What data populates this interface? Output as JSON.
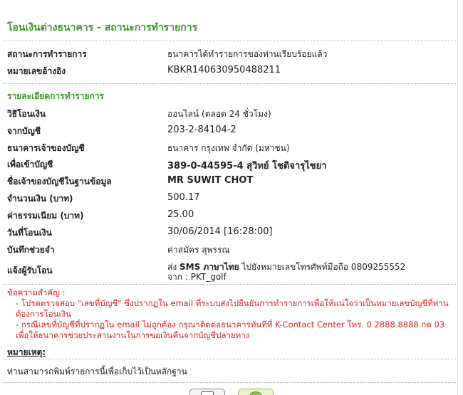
{
  "page": {
    "title": "โอนเงินต่างธนาคาร - สถานะการทำรายการ"
  },
  "status": {
    "status_label": "สถานะการทำรายการ",
    "status_value": "ธนาคารได้ทำรายการของท่านเรียบร้อยแล้ว",
    "ref_label": "หมายเลขอ้างอิง",
    "ref_value": "KBKR140630950488211"
  },
  "details": {
    "section_title": "รายละเอียดการทำรายการ",
    "rows": [
      {
        "label": "วิธีโอนเงิน",
        "value": "ออนไลน์ (ตลอด 24 ชั่วโมง)"
      },
      {
        "label": "จากบัญชี",
        "value": "203-2-84104-2"
      },
      {
        "label": "ธนาคารเจ้าของบัญชี",
        "value": "ธนาคาร กรุงเทพ จำกัด (มหาชน)"
      },
      {
        "label": "เพื่อเข้าบัญชี",
        "value": "389-0-44595-4 สุวิทย์ โชติจารุไชยา"
      },
      {
        "label": "ชื่อเจ้าของบัญชีในฐานข้อมูล",
        "value": "MR SUWIT CHOT"
      },
      {
        "label": "จำนวนเงิน (บาท)",
        "value": "500.17"
      },
      {
        "label": "ค่าธรรมเนียม (บาท)",
        "value": "25.00"
      },
      {
        "label": "วันที่โอนเงิน",
        "value": "30/06/2014 [16:28:00]"
      },
      {
        "label": "บันทึกช่วยจำ",
        "value": "ค่าสมัคร สุพรรณ"
      }
    ],
    "notify": {
      "label": "แจ้งผู้รับโอน",
      "prefix": "ส่ง ",
      "sms": "SMS ภาษาไทย",
      "line1_rest": " ไปยังหมายเลขโทรศัพท์มือถือ 0809255552",
      "line2": "จาก : PKT_golf"
    }
  },
  "notice": {
    "title": "ข้อความสำคัญ :",
    "item1": "- โปรดตรวจสอบ \"เลขที่บัญชี\" ซึ่งปรากฏใน email ที่ระบบส่งไปยืนยันการทำรายการเพื่อให้แน่ใจว่าเป็นหมายเลขบัญชีที่ท่านต้องการโอนเงิน",
    "item2": "- กรณีเลขที่บัญชีที่ปรากฏใน email ไม่ถูกต้อง กรุณาติดต่อธนาคารทันทีที่ K-Contact Center โทร. 0 2888 8888 กด 03 เพื่อให้ธนาคารช่วยประสานงานในการขอเงินคืนจากบัญชีปลายทาง"
  },
  "remark": {
    "title": "หมายเหตุ:",
    "text": "ท่านสามารถพิมพ์รายการนี้เพื่อเก็บไว้เป็นหลักฐาน"
  },
  "buttons": {
    "print_icon": "print-icon",
    "confirm_icon": "ok-icon"
  }
}
